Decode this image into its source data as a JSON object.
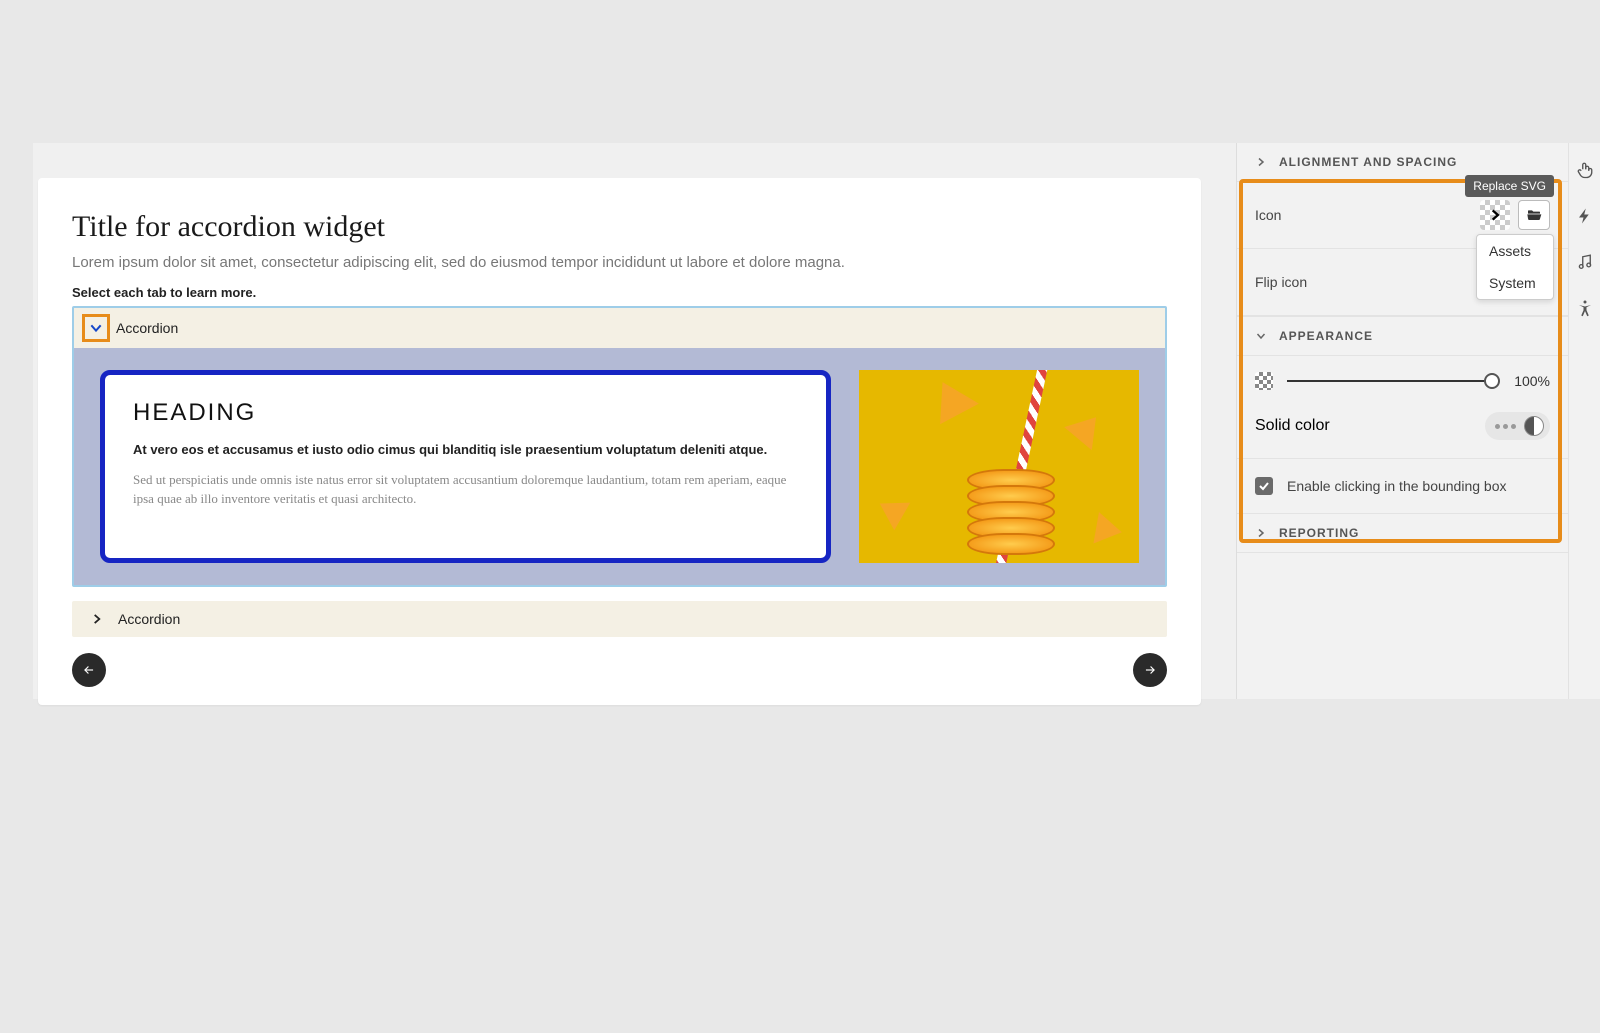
{
  "canvas": {
    "title": "Title for accordion widget",
    "subtitle": "Lorem ipsum dolor sit amet, consectetur adipiscing elit, sed do eiusmod tempor incididunt ut labore et dolore magna.",
    "helper": "Select each tab to learn more.",
    "accordion1_label": "Accordion",
    "card_heading": "HEADING",
    "card_p1": "At vero eos et accusamus et iusto odio cimus qui blanditiq isle praesentium voluptatum deleniti atque.",
    "card_p2": "Sed ut perspiciatis unde omnis iste natus error sit voluptatem accusantium doloremque laudantium, totam rem aperiam, eaque ipsa quae ab illo inventore veritatis et quasi architecto.",
    "accordion2_label": "Accordion"
  },
  "panel": {
    "section_alignment": "ALIGNMENT AND SPACING",
    "icon_label": "Icon",
    "tooltip_replace": "Replace SVG",
    "dropdown_assets": "Assets",
    "dropdown_system": "System",
    "flip_label": "Flip icon",
    "section_appearance": "APPEARANCE",
    "opacity_pct": "100%",
    "solid_label": "Solid color",
    "enable_click": "Enable clicking in the bounding box",
    "section_reporting": "REPORTING"
  }
}
